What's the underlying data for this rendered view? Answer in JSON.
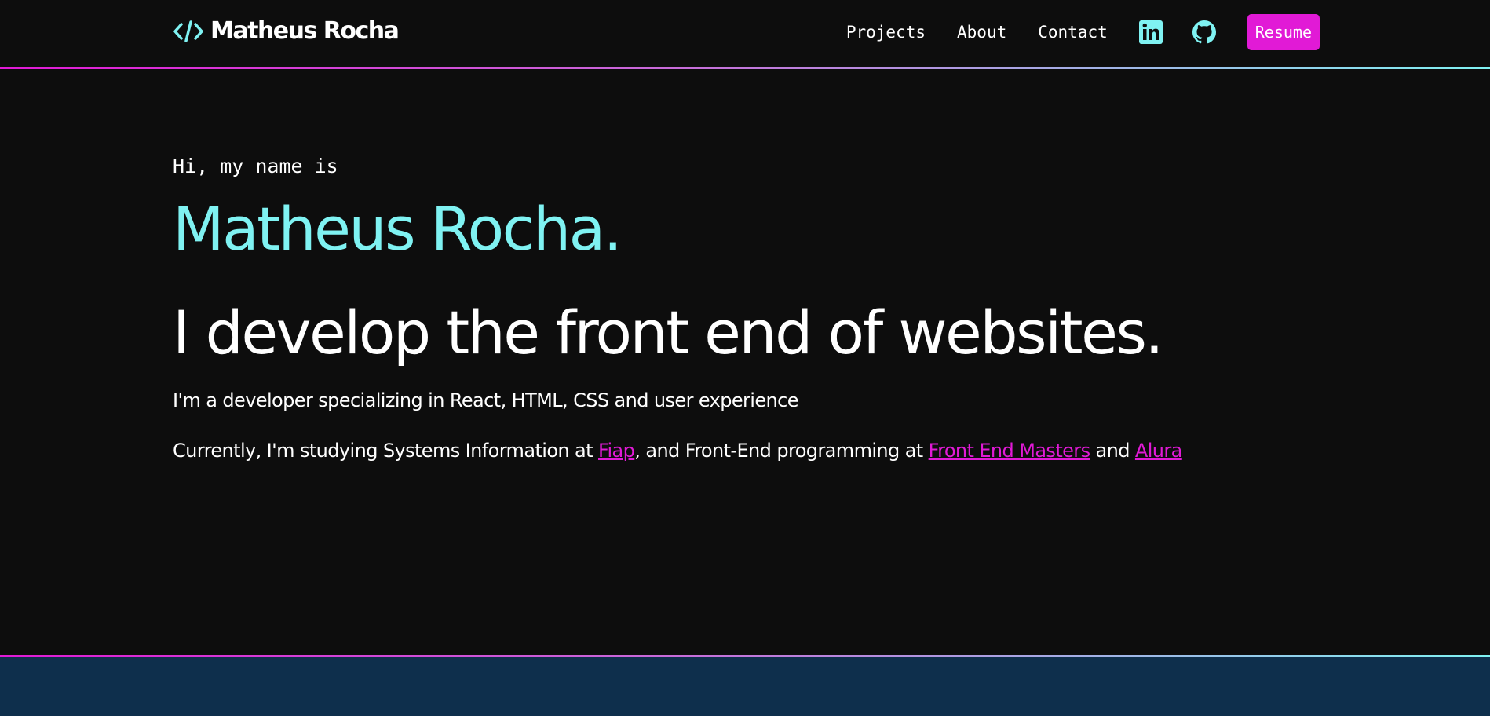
{
  "header": {
    "logo_text": "Matheus Rocha",
    "nav": [
      {
        "label": "Projects"
      },
      {
        "label": "About"
      },
      {
        "label": "Contact"
      }
    ],
    "resume_label": "Resume"
  },
  "hero": {
    "greeting": "Hi, my name is",
    "name": "Matheus Rocha.",
    "tagline": "I develop the front end of websites.",
    "description": "I'm a developer specializing in React, HTML, CSS and user experience",
    "study": {
      "prefix": "Currently, I'm studying Systems Information at ",
      "link1": "Fiap",
      "middle": ", and Front-End programming at ",
      "link2": "Front End Masters",
      "joiner": " and ",
      "link3": "Alura"
    }
  },
  "icons": {
    "logo": "code-brackets-icon",
    "linkedin": "linkedin-icon",
    "github": "github-icon"
  },
  "colors": {
    "background": "#0d0d0d",
    "accent_cyan": "#7ff2f2",
    "accent_magenta": "#e11ad6",
    "footer_band": "#0e2f4c",
    "text": "#ffffff"
  }
}
